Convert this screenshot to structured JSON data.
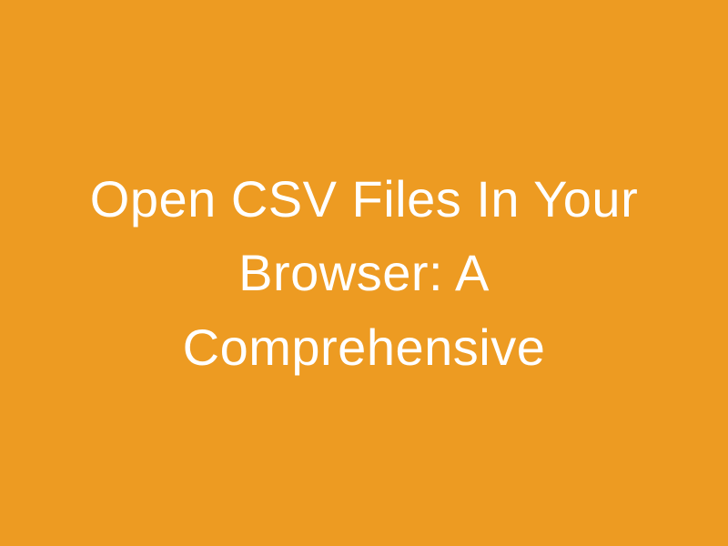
{
  "title": "Open CSV Files In Your Browser: A Comprehensive",
  "colors": {
    "background": "#ed9b22",
    "text": "#ffffff"
  }
}
